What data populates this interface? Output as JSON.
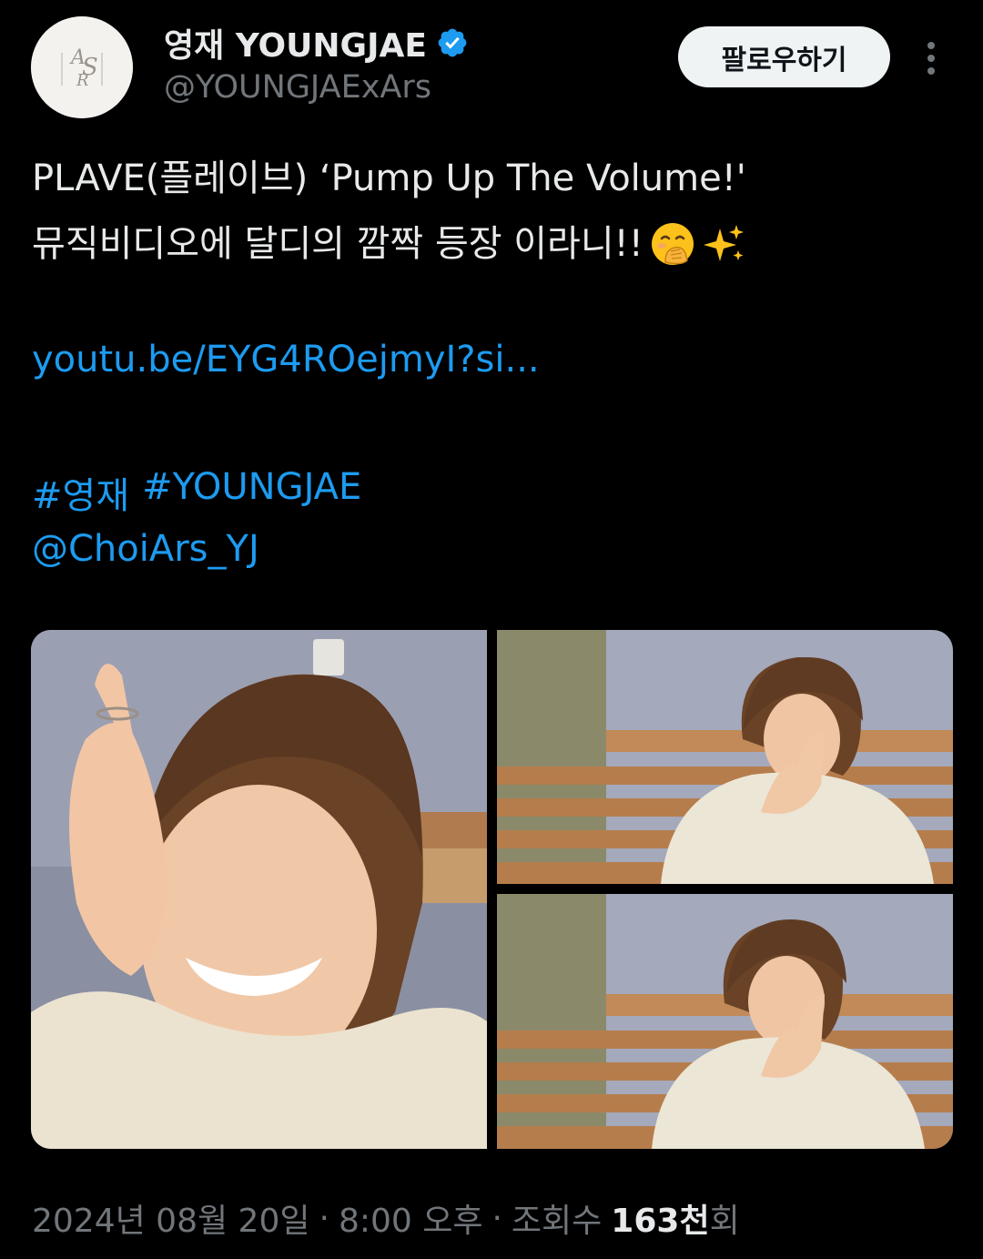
{
  "author": {
    "display_name": "영재 YOUNGJAE",
    "handle": "@YOUNGJAExArs",
    "verified": true,
    "avatar_icon": "ars-monogram-logo",
    "avatar_monogram": "ARS"
  },
  "follow_button_label": "팔로우하기",
  "more_icon": "vertical-ellipsis-icon",
  "tweet": {
    "line1": "PLAVE(플레이브) ‘Pump Up The Volume!'",
    "line2": "뮤직비디오에 달디의 깜짝 등장 이라니!!",
    "emoji_1": "face-with-open-eyes-and-hand-over-mouth-emoji",
    "emoji_2": "sparkles-emoji",
    "link": "youtu.be/EYG4ROejmyI?si...",
    "hashtag_1": "#영재",
    "hashtag_2": "#YOUNGJAE",
    "mention": "@ChoiArs_YJ"
  },
  "media": {
    "count": 3
  },
  "meta": {
    "date": "2024년 08월 20일",
    "separator": "·",
    "time": "8:00 오후",
    "views_label_prefix": "조회수",
    "views_count": "163천",
    "views_label_suffix": "회"
  },
  "colors": {
    "background": "#000000",
    "text_primary": "#e7e9ea",
    "text_secondary": "#71767b",
    "link": "#1d9bf0",
    "verified_badge": "#1d9bf0",
    "follow_button_bg": "#eff3f4"
  }
}
